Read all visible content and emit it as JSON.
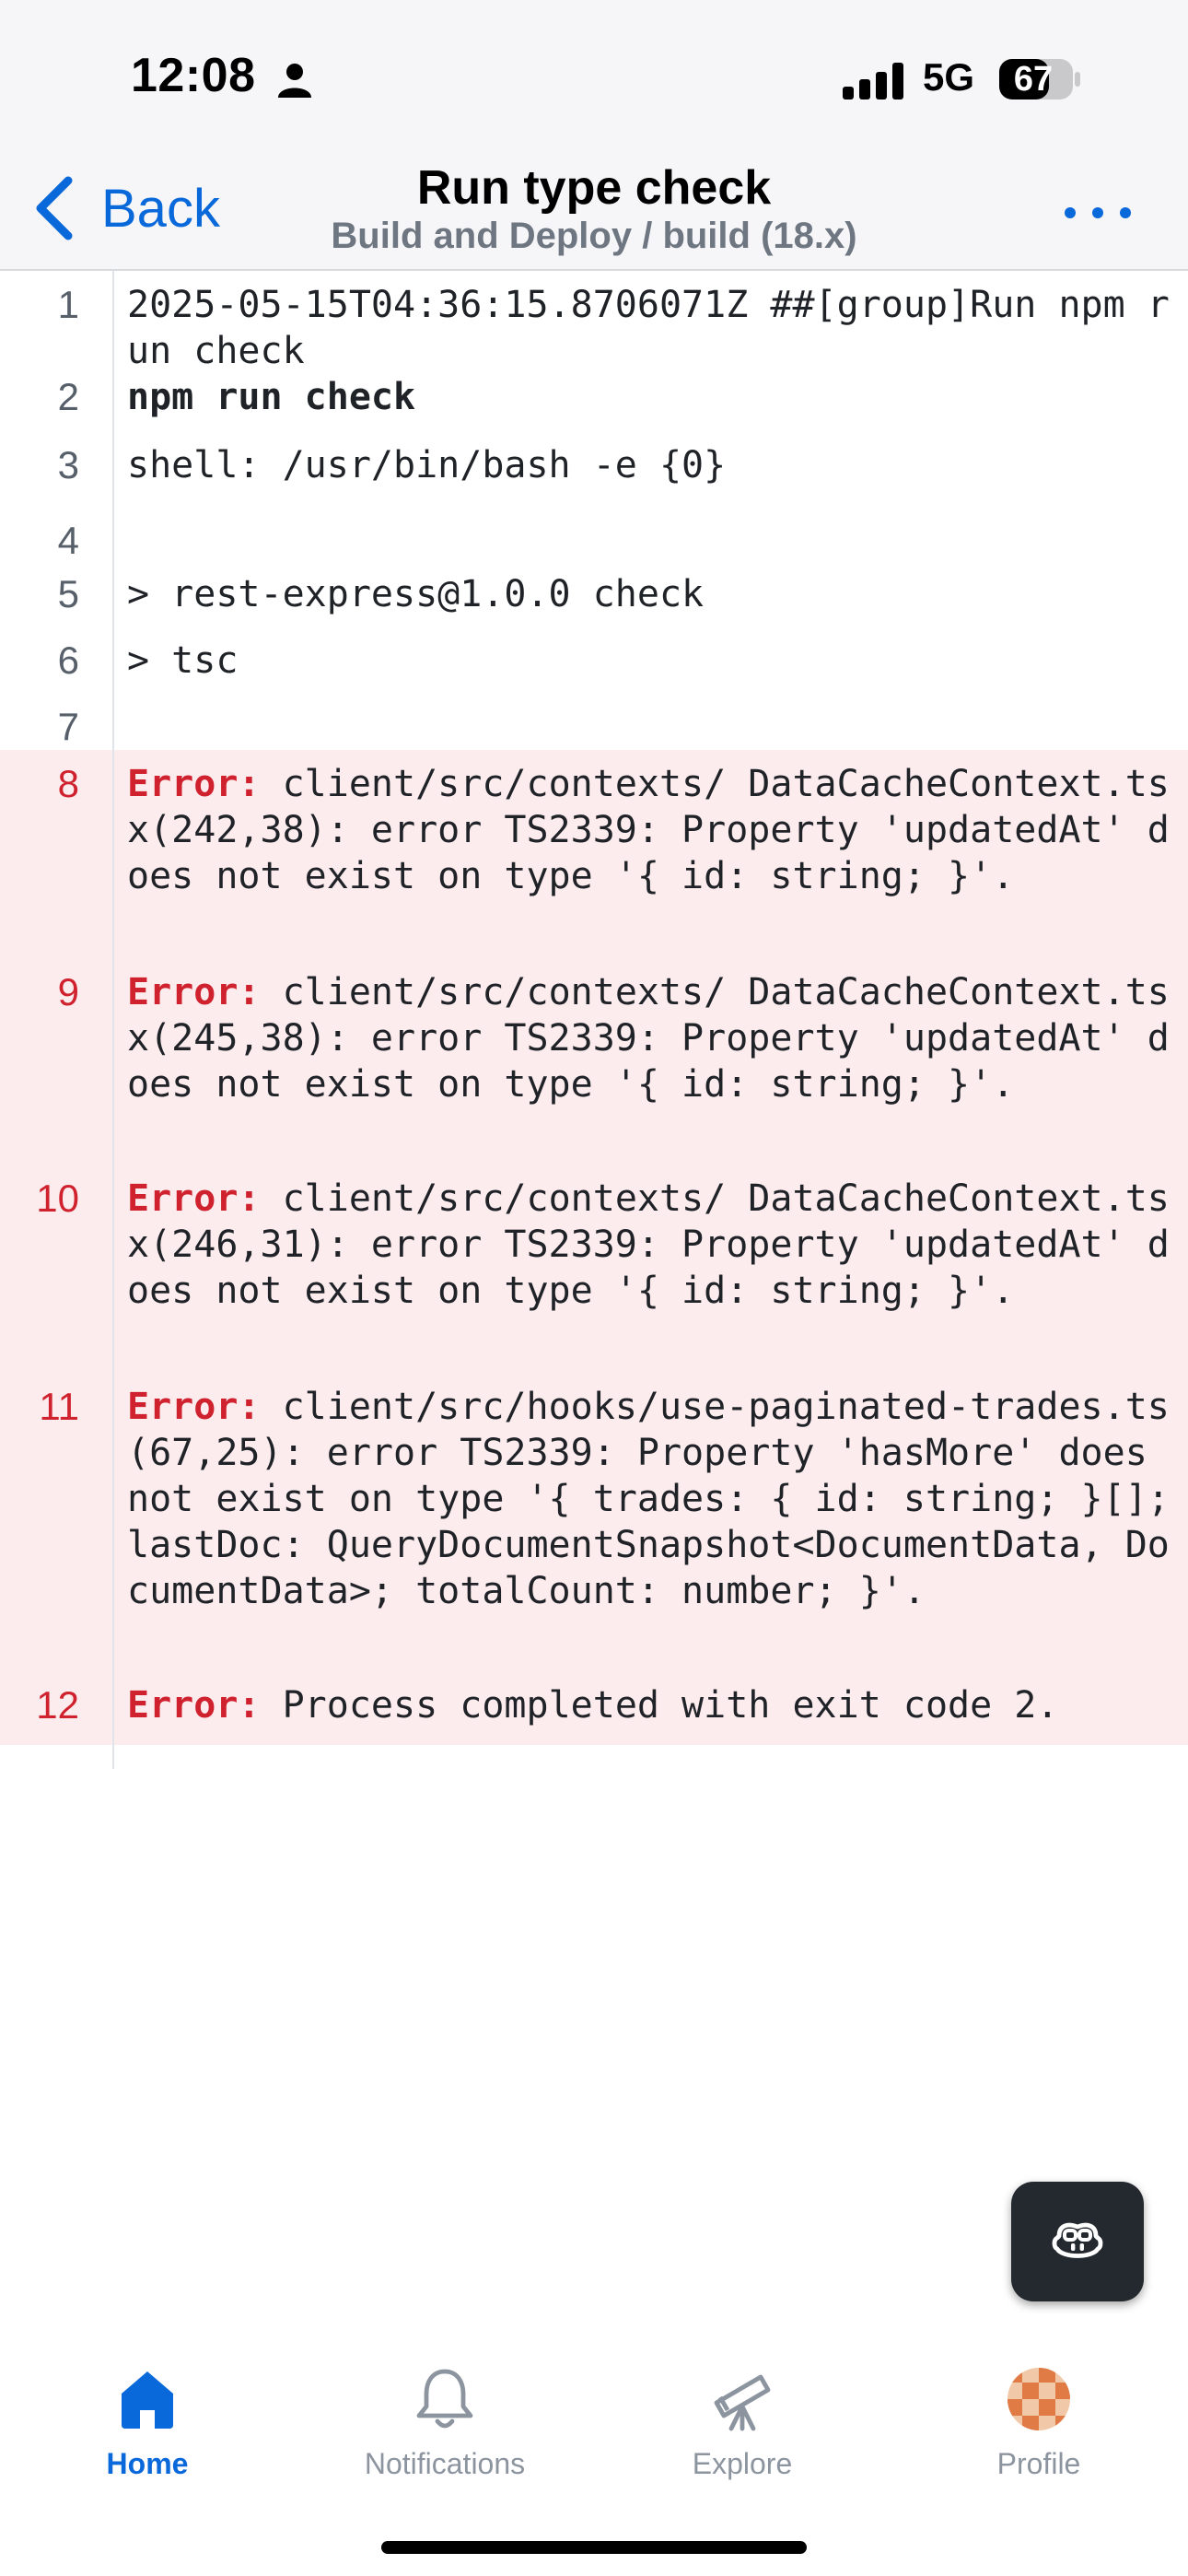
{
  "status_bar": {
    "time": "12:08",
    "network": "5G",
    "battery": "67"
  },
  "nav": {
    "back_label": "Back",
    "title": "Run type check",
    "subtitle": "Build and Deploy / build (18.x)",
    "more_icon": "more-horizontal-icon"
  },
  "log_lines": [
    {
      "n": "1",
      "text": "2025-05-15T04:36:15.8706071Z ##[group]Run npm run check"
    },
    {
      "n": "2",
      "text": "npm run check"
    },
    {
      "n": "3",
      "text": "shell: /usr/bin/bash -e {0}"
    },
    {
      "n": "4",
      "text": ""
    },
    {
      "n": "5",
      "text": "> rest-express@1.0.0 check"
    },
    {
      "n": "6",
      "text": "> tsc"
    },
    {
      "n": "7",
      "text": ""
    },
    {
      "n": "8",
      "prefix": "Error:",
      "text": " client/src/contexts/ DataCacheContext.tsx(242,38): error TS2339: Property 'updatedAt' does not exist on type '{ id: string; }'."
    },
    {
      "n": "9",
      "prefix": "Error:",
      "text": " client/src/contexts/ DataCacheContext.tsx(245,38): error TS2339: Property 'updatedAt' does not exist on type '{ id: string; }'."
    },
    {
      "n": "10",
      "prefix": "Error:",
      "text": " client/src/contexts/ DataCacheContext.tsx(246,31): error TS2339: Property 'updatedAt' does not exist on type '{ id: string; }'."
    },
    {
      "n": "11",
      "prefix": "Error:",
      "text": " client/src/hooks/use-paginated-trades.ts(67,25): error TS2339: Property 'hasMore' does not exist on type '{ trades: { id: string; }[]; lastDoc: QueryDocumentSnapshot<DocumentData, DocumentData>; totalCount: number; }'."
    },
    {
      "n": "12",
      "prefix": "Error:",
      "text": " Process completed with exit code 2."
    }
  ],
  "fab": {
    "icon": "copilot-icon"
  },
  "tabs": [
    {
      "label": "Home",
      "icon": "home-icon",
      "active": true
    },
    {
      "label": "Notifications",
      "icon": "bell-icon",
      "active": false
    },
    {
      "label": "Explore",
      "icon": "telescope-icon",
      "active": false
    },
    {
      "label": "Profile",
      "icon": "avatar-icon",
      "active": false
    }
  ],
  "colors": {
    "accent": "#0969da",
    "error": "#cf222e",
    "error_bg": "#fdecee",
    "command": "#3bb0e8"
  }
}
